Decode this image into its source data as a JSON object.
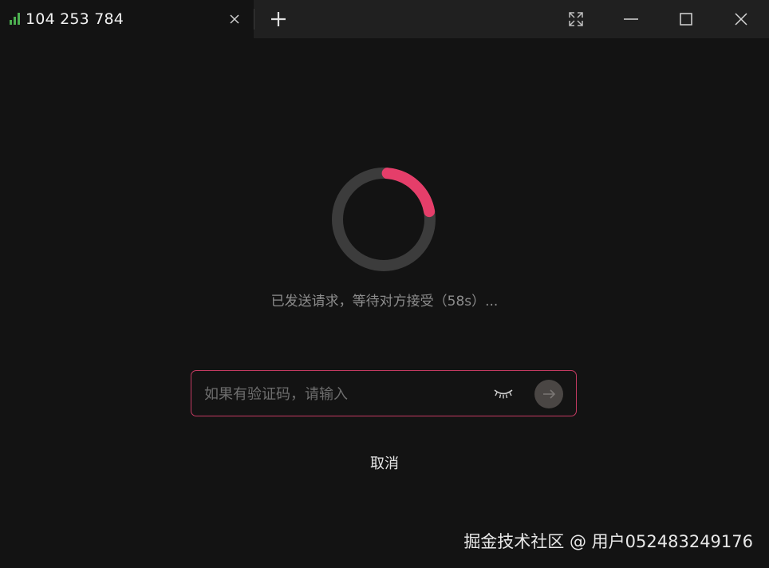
{
  "tab": {
    "title": "104 253 784",
    "signal_color": "#4caf50"
  },
  "icons": {
    "signal": "signal-bars-icon",
    "tab_close": "close-icon",
    "new_tab": "plus-icon",
    "fullscreen": "expand-icon",
    "minimize": "minimize-icon",
    "maximize": "maximize-icon",
    "window_close": "close-icon",
    "eye": "eye-closed-icon",
    "submit": "arrow-right-icon"
  },
  "connection": {
    "progress": 0.21,
    "progress_color": "#e53e6a",
    "track_color": "#3c3c3c",
    "status_text": "已发送请求，等待对方接受（58s）..."
  },
  "code_input": {
    "placeholder": "如果有验证码，请输入",
    "value": "",
    "border_color": "#c43a62"
  },
  "cancel_label": "取消",
  "watermark": "掘金技术社区 @ 用户052483249176"
}
